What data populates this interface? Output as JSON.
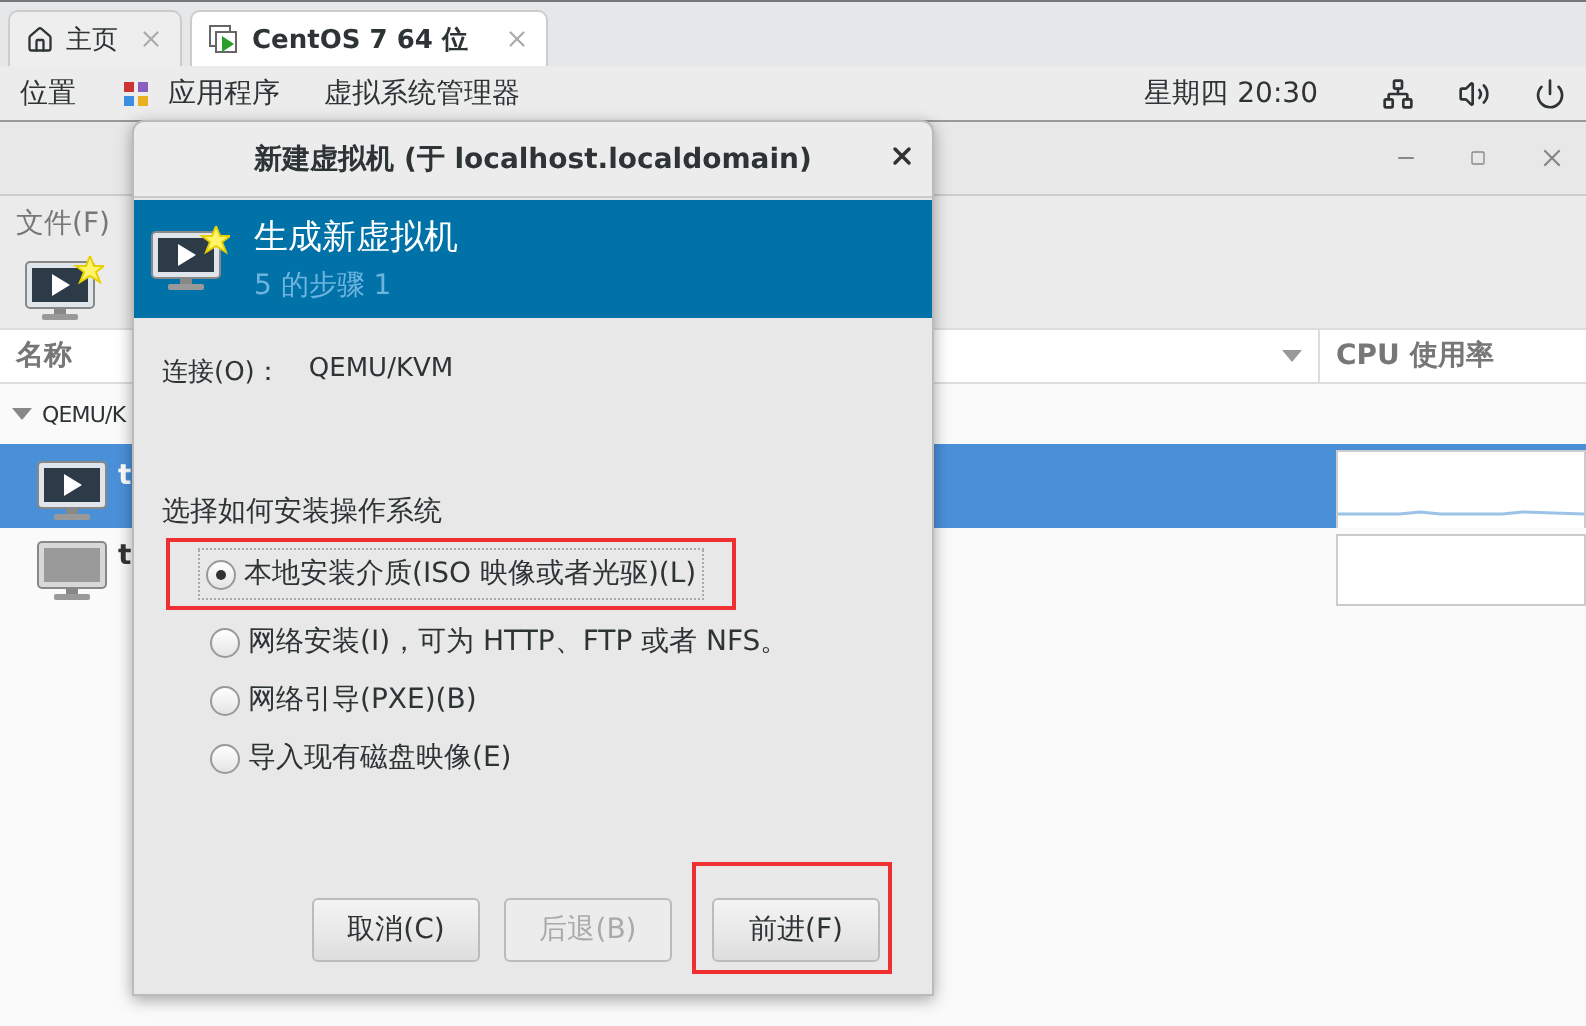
{
  "browser_tabs": [
    {
      "label": "主页",
      "selected": false
    },
    {
      "label": "CentOS 7 64 位",
      "selected": true
    }
  ],
  "top_panel": {
    "menus": [
      "位置",
      "应用程序",
      "虚拟系统管理器"
    ],
    "clock": "星期四 20:30"
  },
  "manager_window": {
    "menu": [
      "文件(F)"
    ],
    "columns": [
      "名称",
      "CPU 使用率"
    ],
    "connection": "QEMU/K",
    "rows": [
      {
        "name": "t",
        "selected": true,
        "running": true
      },
      {
        "name": "t",
        "selected": false,
        "running": false
      }
    ]
  },
  "dialog": {
    "title": "新建虚拟机 (于 localhost.localdomain)",
    "heading": "生成新虚拟机",
    "step": "5 的步骤 1",
    "connection_label": "连接(O)：",
    "connection_value": "QEMU/KVM",
    "install_prompt": "选择如何安装操作系统",
    "options": [
      {
        "label": "本地安装介质(ISO 映像或者光驱)(L)",
        "selected": true,
        "highlighted": true
      },
      {
        "label": "网络安装(I)，可为 HTTP、FTP 或者 NFS。",
        "selected": false,
        "highlighted": false
      },
      {
        "label": "网络引导(PXE)(B)",
        "selected": false,
        "highlighted": false
      },
      {
        "label": "导入现有磁盘映像(E)",
        "selected": false,
        "highlighted": false
      }
    ],
    "buttons": [
      {
        "label": "取消(C)",
        "disabled": false,
        "highlighted": false
      },
      {
        "label": "后退(B)",
        "disabled": true,
        "highlighted": false
      },
      {
        "label": "前进(F)",
        "disabled": false,
        "highlighted": true
      }
    ]
  }
}
